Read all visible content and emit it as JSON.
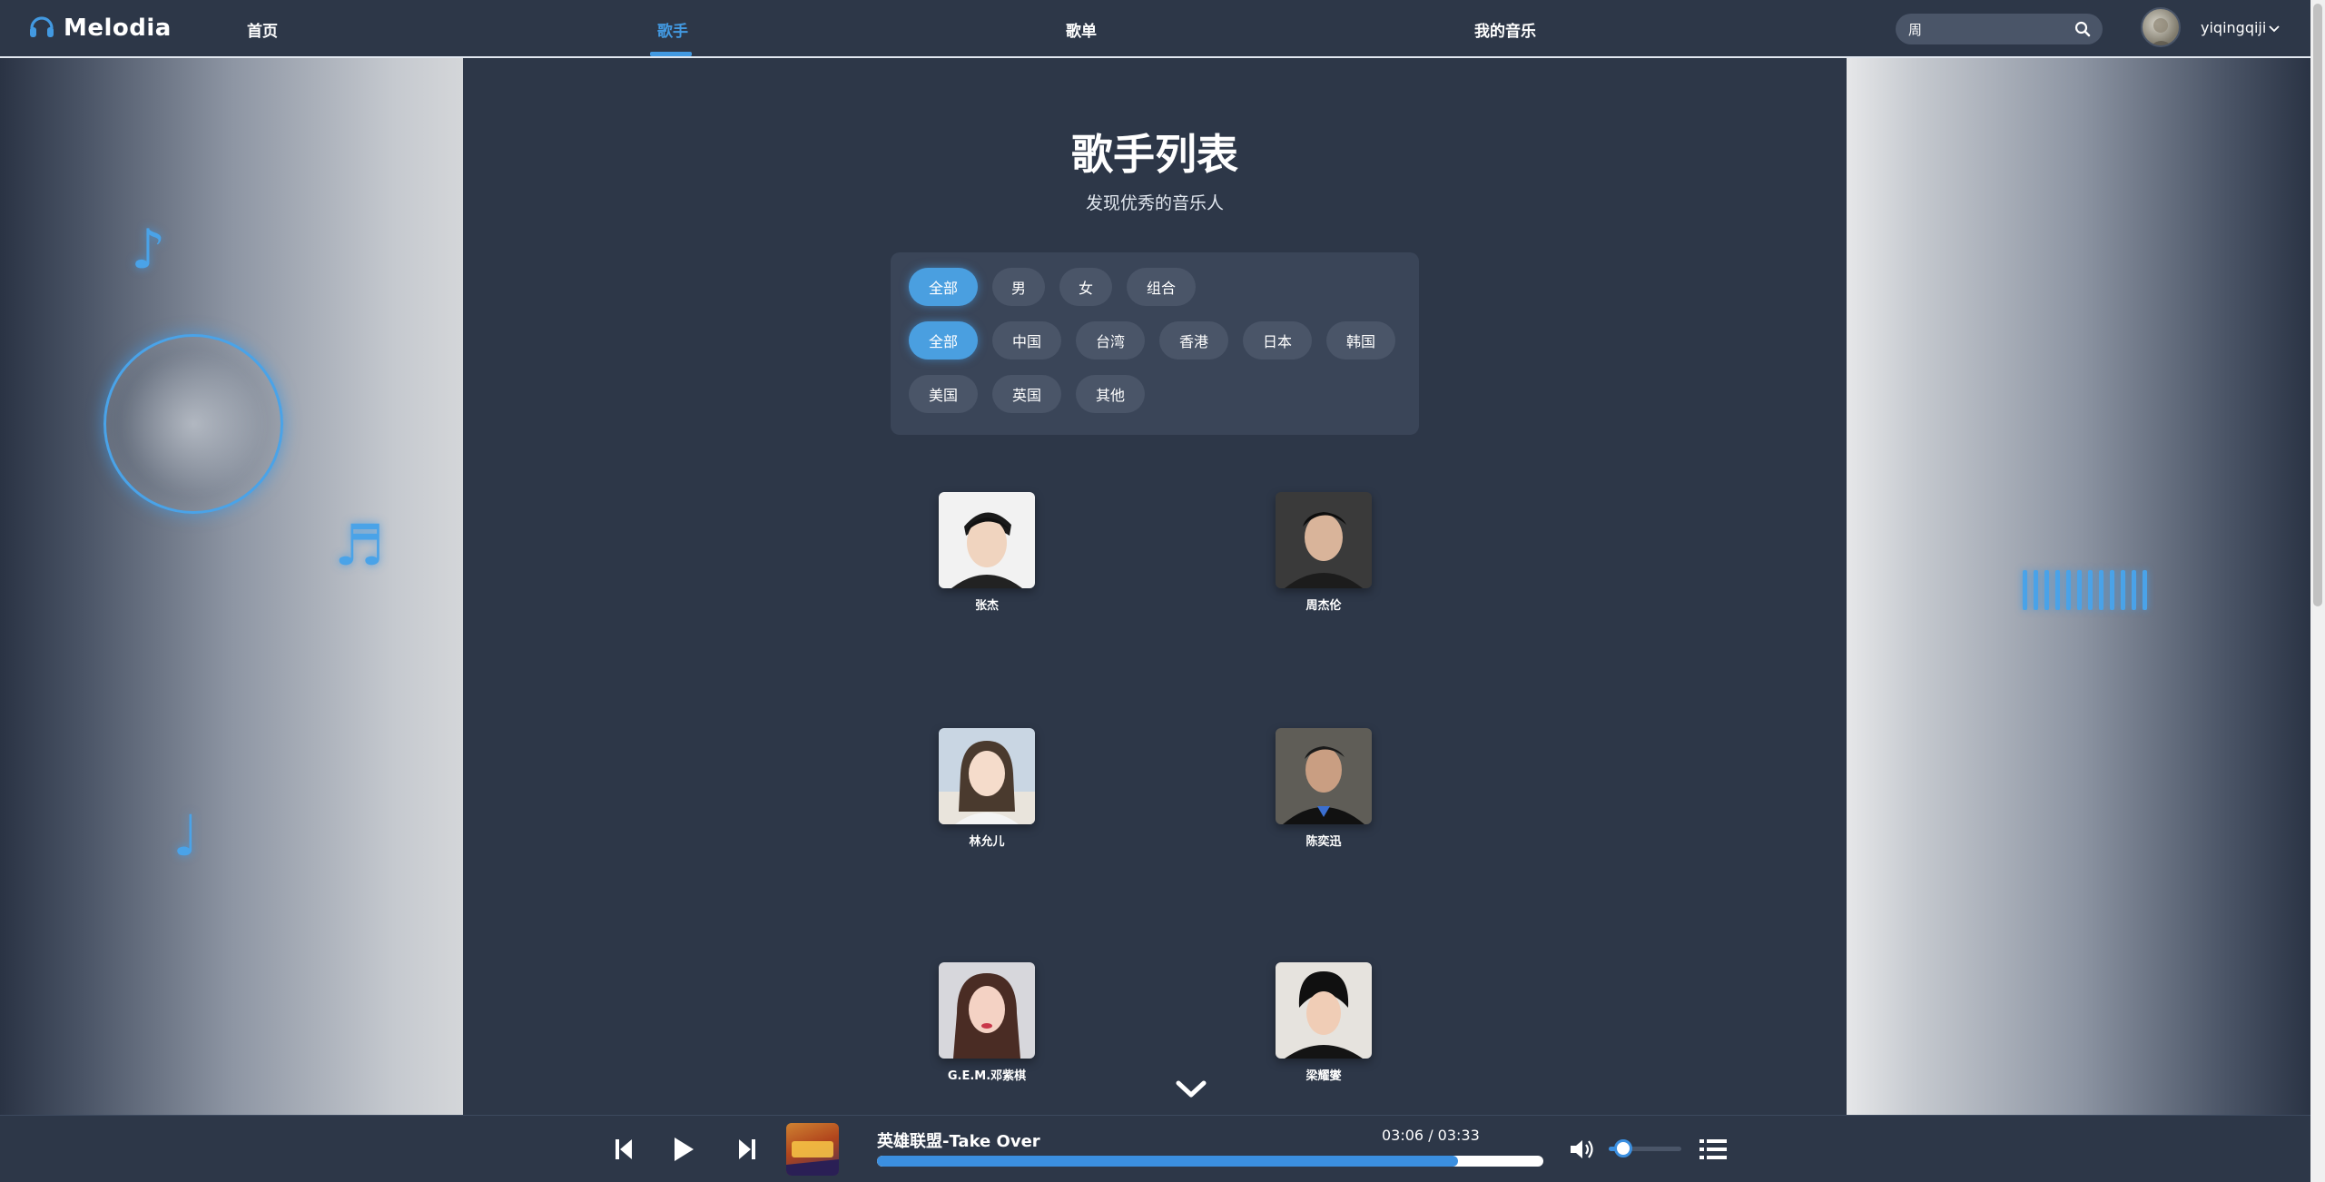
{
  "header": {
    "logo_text": "Melodia",
    "nav": [
      {
        "label": "首页",
        "active": false
      },
      {
        "label": "歌手",
        "active": true
      },
      {
        "label": "歌单",
        "active": false
      },
      {
        "label": "我的音乐",
        "active": false
      }
    ],
    "search_value": "周",
    "username": "yiqingqiji"
  },
  "main": {
    "title": "歌手列表",
    "subtitle": "发现优秀的音乐人",
    "gender_filters": [
      {
        "label": "全部",
        "active": true
      },
      {
        "label": "男",
        "active": false
      },
      {
        "label": "女",
        "active": false
      },
      {
        "label": "组合",
        "active": false
      }
    ],
    "region_filters": [
      {
        "label": "全部",
        "active": true
      },
      {
        "label": "中国",
        "active": false
      },
      {
        "label": "台湾",
        "active": false
      },
      {
        "label": "香港",
        "active": false
      },
      {
        "label": "日本",
        "active": false
      },
      {
        "label": "韩国",
        "active": false
      },
      {
        "label": "美国",
        "active": false
      },
      {
        "label": "英国",
        "active": false
      },
      {
        "label": "其他",
        "active": false
      }
    ],
    "artists": [
      {
        "name": "张杰"
      },
      {
        "name": "周杰伦"
      },
      {
        "name": "林允儿"
      },
      {
        "name": "陈奕迅"
      },
      {
        "name": "G.E.M.邓紫棋"
      },
      {
        "name": "梁耀燮"
      }
    ]
  },
  "player": {
    "song_title": "英雄联盟-Take Over",
    "time": "03:06 / 03:33",
    "progress": 0.872,
    "volume": 0.2
  },
  "colors": {
    "accent": "#4299e1",
    "background": "#2d3748",
    "chip": "#4a5568"
  },
  "icons": [
    "headphones-icon",
    "search-icon",
    "chevron-down-icon",
    "music-note-icon",
    "prev-icon",
    "play-icon",
    "next-icon",
    "volume-icon",
    "playlist-icon"
  ]
}
